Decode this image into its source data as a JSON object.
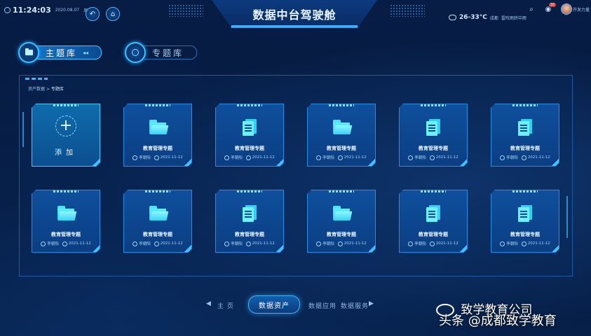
{
  "header": {
    "time": "11:24:03",
    "date": "2020.08.07",
    "weekday": "周三",
    "title": "数据中台驾驶舱",
    "weather_temp": "26-33°C",
    "weather_city": "成都",
    "weather_desc": "雷阵雨转中雨",
    "notification_count": "10",
    "user_name": "开发力量"
  },
  "library_tabs": [
    {
      "label": "主题库",
      "active": true
    },
    {
      "label": "专题库",
      "active": false
    }
  ],
  "breadcrumb": {
    "root": "资产数据",
    "sep": ">",
    "current": "专题库"
  },
  "add_card": {
    "label": "添加"
  },
  "cards": [
    {
      "icon": "folder-icon",
      "title": "教育管理专题",
      "author": "李朝阳",
      "date": "2021-11-12"
    },
    {
      "icon": "document-icon",
      "title": "教育管理专题",
      "author": "李朝阳",
      "date": "2021-11-12"
    },
    {
      "icon": "folder-icon",
      "title": "教育管理专题",
      "author": "李朝阳",
      "date": "2021-11-12"
    },
    {
      "icon": "document-icon",
      "title": "教育管理专题",
      "author": "李朝阳",
      "date": "2021-11-12"
    },
    {
      "icon": "document-icon",
      "title": "教育管理专题",
      "author": "李朝阳",
      "date": "2021-11-12"
    },
    {
      "icon": "folder-icon",
      "title": "教育管理专题",
      "author": "李朝阳",
      "date": "2021-11-12"
    },
    {
      "icon": "folder-icon",
      "title": "教育管理专题",
      "author": "李朝阳",
      "date": "2021-11-12"
    },
    {
      "icon": "document-icon",
      "title": "教育管理专题",
      "author": "李朝阳",
      "date": "2021-11-12"
    },
    {
      "icon": "folder-icon",
      "title": "教育管理专题",
      "author": "李朝阳",
      "date": "2021-11-12"
    },
    {
      "icon": "document-icon",
      "title": "教育管理专题",
      "author": "李朝阳",
      "date": "2021-11-12"
    },
    {
      "icon": "document-icon",
      "title": "教育管理专题",
      "author": "李朝阳",
      "date": "2021-11-12"
    }
  ],
  "bottom_nav": {
    "home": "主 页",
    "active": "数据资产",
    "app": "数据应用",
    "service": "数据服务"
  },
  "watermark": {
    "line1": "致学教育公司",
    "line2": "头条 @成都致学教育"
  },
  "colors": {
    "background": "#061a3f",
    "accent": "#3fb2ff",
    "icon": "#4fe3ff"
  }
}
